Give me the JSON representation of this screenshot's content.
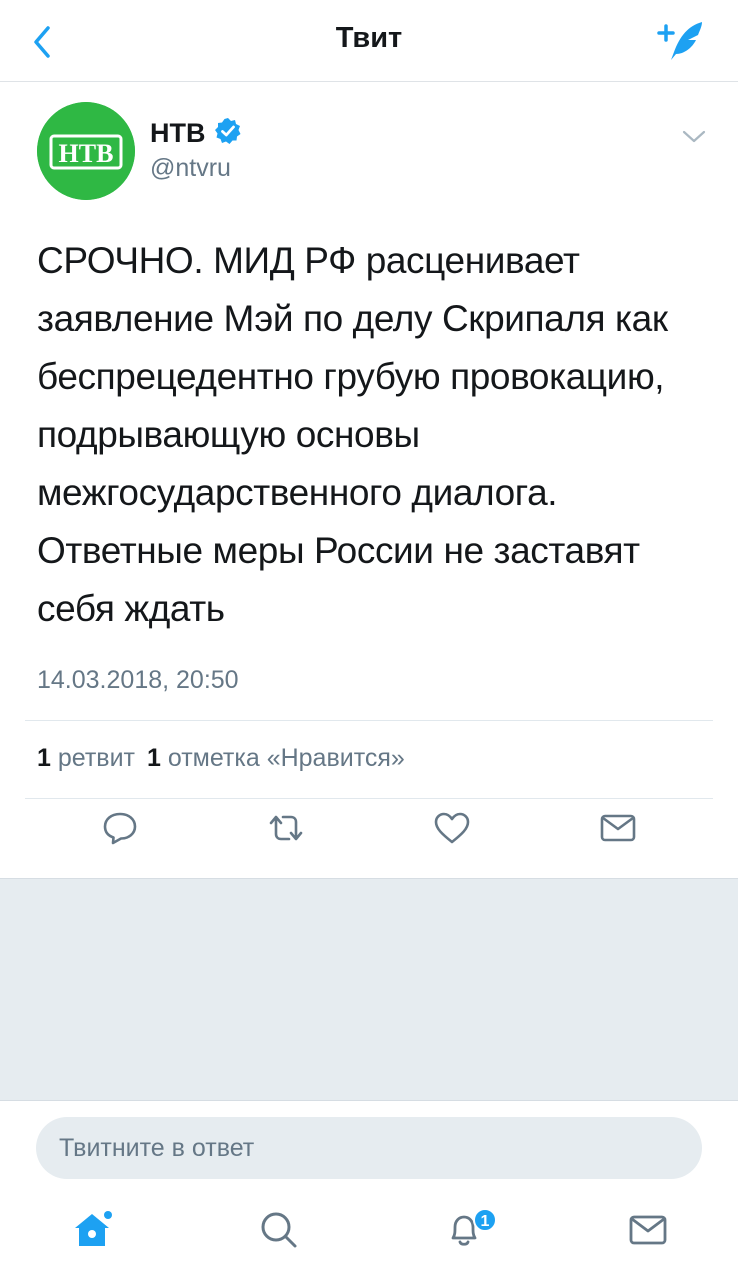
{
  "header": {
    "title": "Твит",
    "back_icon": "chevron-left-icon",
    "compose_icon": "compose-feather-icon",
    "accent_color": "#1da1f2"
  },
  "tweet": {
    "author": {
      "name": "НТВ",
      "handle": "@ntvru",
      "verified": true,
      "avatar_logo_text": "НТВ",
      "avatar_color": "#2fb844"
    },
    "text": "СРОЧНО. МИД РФ расценивает заявление Мэй по делу Скрипаля как беспрецедентно грубую провокацию, подрывающую основы межгосударственного диалога. Ответные меры России не заставят себя ждать",
    "timestamp": "14.03.2018, 20:50",
    "stats": {
      "retweets_count": "1",
      "retweets_label": "ретвит",
      "likes_count": "1",
      "likes_label": "отметка «Нравится»"
    },
    "actions": [
      "reply-icon",
      "retweet-icon",
      "like-icon",
      "direct-message-icon"
    ]
  },
  "reply": {
    "placeholder": "Твитните в ответ"
  },
  "tabbar": {
    "items": [
      "home-icon",
      "search-icon",
      "notifications-icon",
      "messages-icon"
    ],
    "notifications_badge": "1"
  }
}
